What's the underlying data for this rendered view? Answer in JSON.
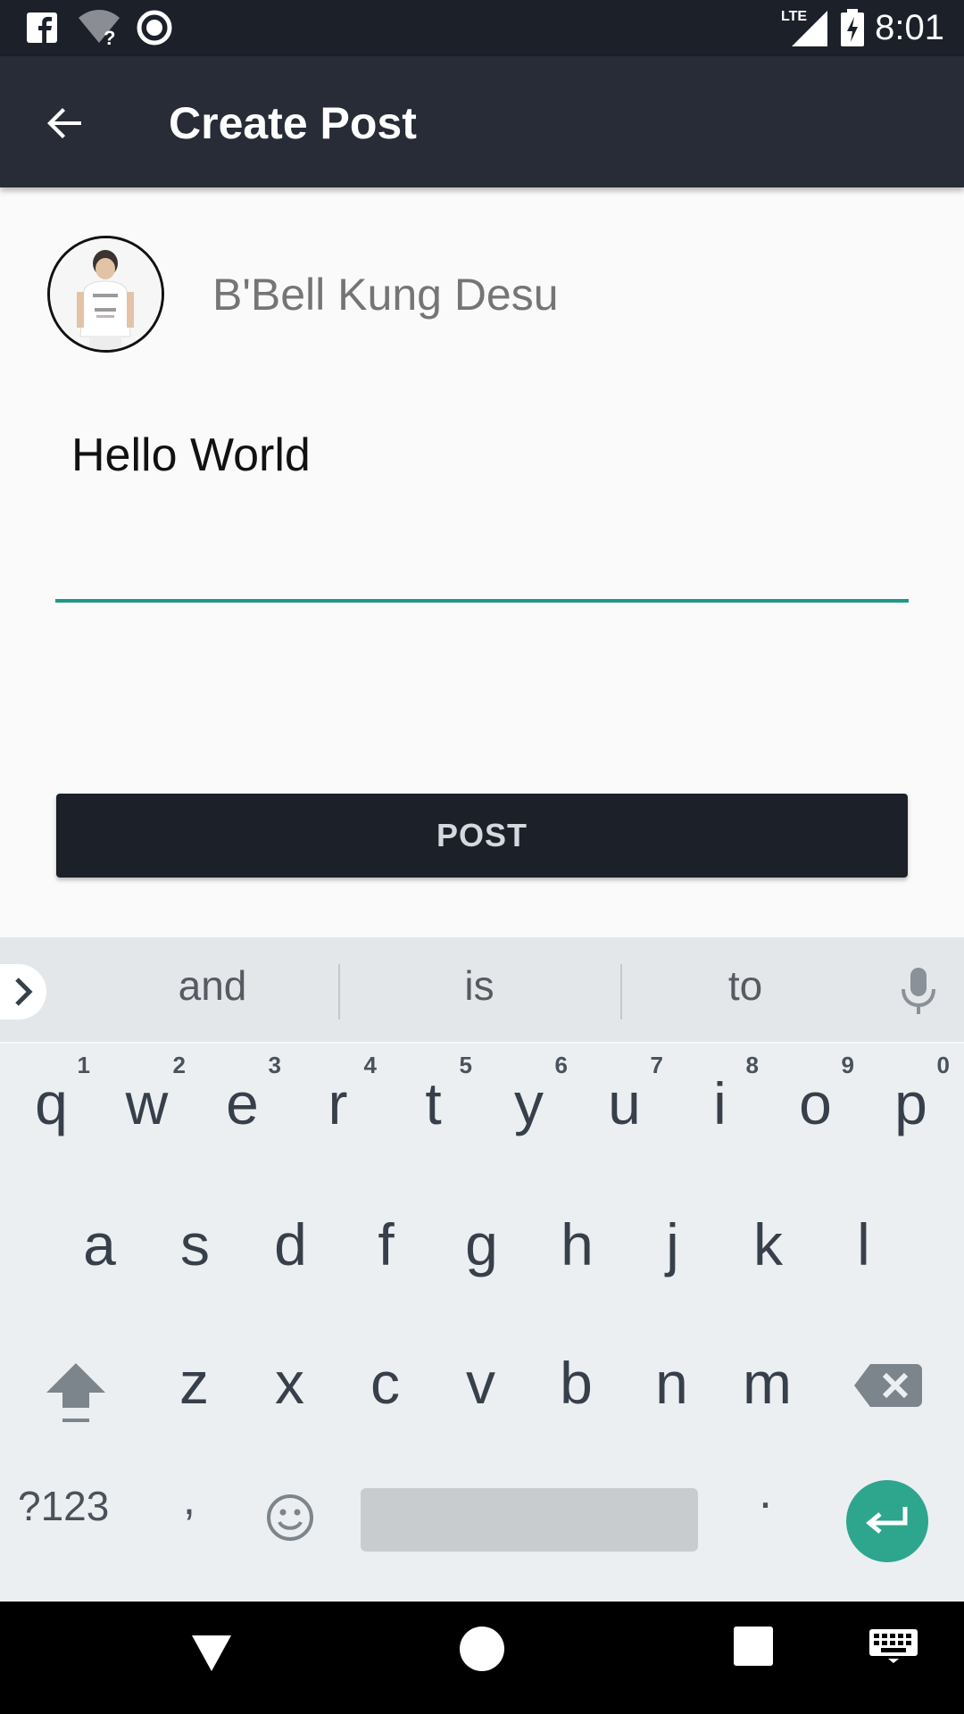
{
  "status_bar": {
    "time": "8:01",
    "icons": [
      "facebook-icon",
      "wifi-unknown-icon",
      "record-icon",
      "lte-signal-icon",
      "battery-charging-icon"
    ],
    "network_label": "LTE"
  },
  "app_bar": {
    "title": "Create Post",
    "back_icon": "arrow-back-icon"
  },
  "author": {
    "name": "B'Bell Kung Desu"
  },
  "post_input": {
    "value": "Hello World"
  },
  "post_button": {
    "label": "POST"
  },
  "keyboard": {
    "suggestions": [
      "and",
      "is",
      "to"
    ],
    "row1": [
      {
        "ch": "q",
        "num": "1"
      },
      {
        "ch": "w",
        "num": "2"
      },
      {
        "ch": "e",
        "num": "3"
      },
      {
        "ch": "r",
        "num": "4"
      },
      {
        "ch": "t",
        "num": "5"
      },
      {
        "ch": "y",
        "num": "6"
      },
      {
        "ch": "u",
        "num": "7"
      },
      {
        "ch": "i",
        "num": "8"
      },
      {
        "ch": "o",
        "num": "9"
      },
      {
        "ch": "p",
        "num": "0"
      }
    ],
    "row2": [
      "a",
      "s",
      "d",
      "f",
      "g",
      "h",
      "j",
      "k",
      "l"
    ],
    "row3": [
      "z",
      "x",
      "c",
      "v",
      "b",
      "n",
      "m"
    ],
    "symbols_label": "?123",
    "comma_label": ",",
    "period_label": "."
  },
  "colors": {
    "accent": "#1d9888",
    "enter_key": "#2ea68e",
    "app_bar": "#272c36",
    "status_bar": "#1b2029"
  }
}
